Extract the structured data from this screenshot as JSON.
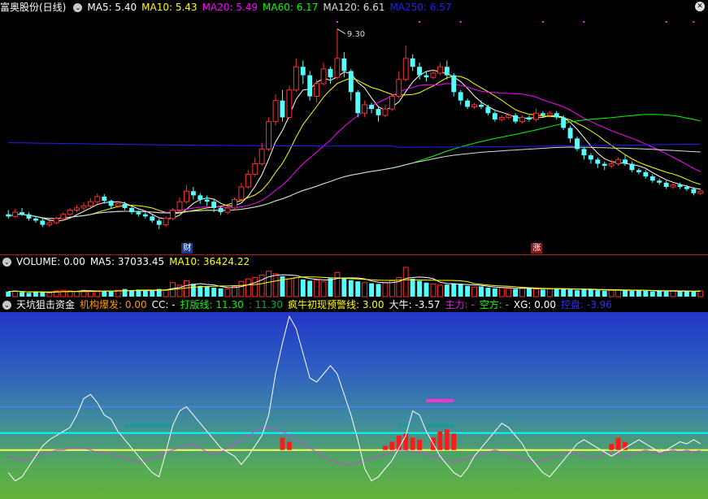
{
  "price_panel": {
    "title": "富奥股份(日线)",
    "ma_labels": [
      {
        "text": "MA5: 5.40",
        "color": "#ffffff"
      },
      {
        "text": "MA10: 5.43",
        "color": "#ffff00"
      },
      {
        "text": "MA20: 5.49",
        "color": "#ff00ff"
      },
      {
        "text": "MA60: 6.17",
        "color": "#00ff00"
      },
      {
        "text": "MA120: 6.61",
        "color": "#dcdcdc"
      },
      {
        "text": "MA250: 6.57",
        "color": "#2020ff"
      }
    ],
    "peak_label": "9.30",
    "event_tags": [
      {
        "text": "财",
        "color": "#1a3a8a"
      },
      {
        "text": "涨",
        "color": "#8a1a1a"
      }
    ]
  },
  "volume_panel": {
    "labels": [
      {
        "text": "VOLUME: 0.00",
        "color": "#ffffff"
      },
      {
        "text": "MA5: 37033.45",
        "color": "#ffffff"
      },
      {
        "text": "MA10: 36424.22",
        "color": "#ffff00"
      }
    ]
  },
  "indicator_panel": {
    "labels": [
      {
        "text": "天坑狙击资金",
        "color": "#ffffff"
      },
      {
        "text": "机构爆发: 0.00",
        "color": "#ff9900"
      },
      {
        "text": "CC: -",
        "color": "#ffffff"
      },
      {
        "text": "打版线: 11.30",
        "color": "#00ff00"
      },
      {
        "text": ": 11.30",
        "color": "#00aa55"
      },
      {
        "text": "疯牛初现预警线: 3.00",
        "color": "#ffff00"
      },
      {
        "text": "大牛: -3.57",
        "color": "#ffffff"
      },
      {
        "text": "主力: -",
        "color": "#ff00ff"
      },
      {
        "text": "空方: -",
        "color": "#00ff00"
      },
      {
        "text": "XG: 0.00",
        "color": "#ffffff"
      },
      {
        "text": "控盘: -3.96",
        "color": "#3030ff"
      }
    ]
  },
  "chart_data": [
    {
      "type": "candlestick",
      "title": "富奥股份(日线)",
      "ylim": [
        4.2,
        9.6
      ],
      "peak": 9.3,
      "candles": [
        [
          4.9,
          4.85,
          5.0,
          4.8
        ],
        [
          4.85,
          4.95,
          5.02,
          4.82
        ],
        [
          4.95,
          4.9,
          5.05,
          4.86
        ],
        [
          4.9,
          4.8,
          4.95,
          4.75
        ],
        [
          4.8,
          4.75,
          4.85,
          4.7
        ],
        [
          4.75,
          4.65,
          4.8,
          4.6
        ],
        [
          4.65,
          4.7,
          4.75,
          4.6
        ],
        [
          4.7,
          4.8,
          4.85,
          4.66
        ],
        [
          4.8,
          4.9,
          4.95,
          4.76
        ],
        [
          4.9,
          5.0,
          5.05,
          4.86
        ],
        [
          5.0,
          5.05,
          5.12,
          4.95
        ],
        [
          5.05,
          5.1,
          5.18,
          5.0
        ],
        [
          5.1,
          5.2,
          5.28,
          5.05
        ],
        [
          5.2,
          5.32,
          5.4,
          5.15
        ],
        [
          5.32,
          5.22,
          5.38,
          5.15
        ],
        [
          5.22,
          5.1,
          5.25,
          5.05
        ],
        [
          5.1,
          5.15,
          5.22,
          5.05
        ],
        [
          5.15,
          5.05,
          5.2,
          5.0
        ],
        [
          5.05,
          4.95,
          5.1,
          4.9
        ],
        [
          4.95,
          4.9,
          5.0,
          4.85
        ],
        [
          4.9,
          4.85,
          4.95,
          4.8
        ],
        [
          4.85,
          4.75,
          4.9,
          4.7
        ],
        [
          4.75,
          4.65,
          4.8,
          4.55
        ],
        [
          4.65,
          4.8,
          4.85,
          4.6
        ],
        [
          4.8,
          5.0,
          5.05,
          4.76
        ],
        [
          5.0,
          5.2,
          5.3,
          4.95
        ],
        [
          5.2,
          5.45,
          5.6,
          5.15
        ],
        [
          5.45,
          5.35,
          5.55,
          5.25
        ],
        [
          5.35,
          5.25,
          5.4,
          5.15
        ],
        [
          5.25,
          5.2,
          5.35,
          5.1
        ],
        [
          5.2,
          5.05,
          5.25,
          4.95
        ],
        [
          5.05,
          4.95,
          5.1,
          4.88
        ],
        [
          4.95,
          5.05,
          5.1,
          4.9
        ],
        [
          5.05,
          5.25,
          5.3,
          5.0
        ],
        [
          5.25,
          5.55,
          5.65,
          5.2
        ],
        [
          5.55,
          5.85,
          5.95,
          5.5
        ],
        [
          5.85,
          6.1,
          6.25,
          5.8
        ],
        [
          6.1,
          6.45,
          6.6,
          6.05
        ],
        [
          6.45,
          7.1,
          7.2,
          6.4
        ],
        [
          7.1,
          7.6,
          7.75,
          7.0
        ],
        [
          7.6,
          7.2,
          7.85,
          7.1
        ],
        [
          7.2,
          7.85,
          7.95,
          7.15
        ],
        [
          7.85,
          8.4,
          8.6,
          7.8
        ],
        [
          8.4,
          8.2,
          8.55,
          8.0
        ],
        [
          8.2,
          7.7,
          8.3,
          7.6
        ],
        [
          7.7,
          8.0,
          8.1,
          7.55
        ],
        [
          8.0,
          8.35,
          8.5,
          7.95
        ],
        [
          8.35,
          8.15,
          8.4,
          8.0
        ],
        [
          8.15,
          8.6,
          9.3,
          8.1
        ],
        [
          8.6,
          8.3,
          8.75,
          8.15
        ],
        [
          8.3,
          7.8,
          8.35,
          7.6
        ],
        [
          7.8,
          7.3,
          7.85,
          7.2
        ],
        [
          7.3,
          7.5,
          7.6,
          7.2
        ],
        [
          7.5,
          7.4,
          7.55,
          7.3
        ],
        [
          7.4,
          7.25,
          7.45,
          7.1
        ],
        [
          7.25,
          7.4,
          7.5,
          7.2
        ],
        [
          7.4,
          7.7,
          7.75,
          7.35
        ],
        [
          7.7,
          8.1,
          8.3,
          7.65
        ],
        [
          8.1,
          8.6,
          8.9,
          8.05
        ],
        [
          8.6,
          8.4,
          8.7,
          8.3
        ],
        [
          8.4,
          8.2,
          8.5,
          8.1
        ],
        [
          8.2,
          8.15,
          8.3,
          8.05
        ],
        [
          8.15,
          8.25,
          8.35,
          8.1
        ],
        [
          8.25,
          8.4,
          8.5,
          8.2
        ],
        [
          8.4,
          8.2,
          8.55,
          8.1
        ],
        [
          8.2,
          7.8,
          8.25,
          7.7
        ],
        [
          7.8,
          7.6,
          7.85,
          7.5
        ],
        [
          7.6,
          7.45,
          7.65,
          7.4
        ],
        [
          7.45,
          7.5,
          7.55,
          7.4
        ],
        [
          7.5,
          7.45,
          7.6,
          7.4
        ],
        [
          7.45,
          7.3,
          7.5,
          7.25
        ],
        [
          7.3,
          7.15,
          7.35,
          7.1
        ],
        [
          7.15,
          7.2,
          7.25,
          7.1
        ],
        [
          7.2,
          7.25,
          7.3,
          7.15
        ],
        [
          7.25,
          7.1,
          7.3,
          7.05
        ],
        [
          7.1,
          7.2,
          7.25,
          7.05
        ],
        [
          7.2,
          7.15,
          7.25,
          7.1
        ],
        [
          7.15,
          7.3,
          7.4,
          7.1
        ],
        [
          7.3,
          7.25,
          7.35,
          7.2
        ],
        [
          7.25,
          7.3,
          7.35,
          7.2
        ],
        [
          7.3,
          7.2,
          7.35,
          7.15
        ],
        [
          7.2,
          6.95,
          7.25,
          6.9
        ],
        [
          6.95,
          6.7,
          7.0,
          6.6
        ],
        [
          6.7,
          6.45,
          6.75,
          6.4
        ],
        [
          6.45,
          6.3,
          6.5,
          6.2
        ],
        [
          6.3,
          6.2,
          6.35,
          6.1
        ],
        [
          6.2,
          6.1,
          6.25,
          6.0
        ],
        [
          6.1,
          6.05,
          6.15,
          5.95
        ],
        [
          6.05,
          6.1,
          6.2,
          6.0
        ],
        [
          6.1,
          6.2,
          6.25,
          6.05
        ],
        [
          6.2,
          6.1,
          6.3,
          6.05
        ],
        [
          6.1,
          5.95,
          6.15,
          5.9
        ],
        [
          5.95,
          5.9,
          6.0,
          5.85
        ],
        [
          5.9,
          5.8,
          5.95,
          5.75
        ],
        [
          5.8,
          5.7,
          5.85,
          5.65
        ],
        [
          5.7,
          5.65,
          5.75,
          5.6
        ],
        [
          5.65,
          5.55,
          5.7,
          5.5
        ],
        [
          5.55,
          5.6,
          5.65,
          5.5
        ],
        [
          5.6,
          5.55,
          5.65,
          5.5
        ],
        [
          5.55,
          5.5,
          5.6,
          5.45
        ],
        [
          5.5,
          5.4,
          5.55,
          5.35
        ],
        [
          5.4,
          5.45,
          5.5,
          5.35
        ]
      ],
      "ma_series": [
        {
          "name": "MA5",
          "color": "#ffffff"
        },
        {
          "name": "MA10",
          "color": "#ffff00"
        },
        {
          "name": "MA20",
          "color": "#ff00ff"
        },
        {
          "name": "MA60",
          "color": "#00ff00"
        },
        {
          "name": "MA120",
          "color": "#dcdcdc"
        },
        {
          "name": "MA250",
          "color": "#2020ff",
          "values_hint": "flat near 6.6 then 6.57"
        }
      ]
    },
    {
      "type": "bar",
      "title": "VOLUME",
      "ma5": 37033.45,
      "ma10": 36424.22,
      "values": [
        8,
        9,
        7,
        6,
        8,
        7,
        6,
        9,
        10,
        9,
        8,
        10,
        9,
        8,
        9,
        8,
        10,
        12,
        9,
        11,
        10,
        9,
        12,
        11,
        22,
        18,
        25,
        20,
        17,
        16,
        14,
        13,
        12,
        16,
        24,
        28,
        30,
        34,
        40,
        36,
        32,
        28,
        30,
        27,
        25,
        26,
        24,
        29,
        38,
        30,
        26,
        24,
        22,
        21,
        20,
        22,
        25,
        30,
        46,
        28,
        25,
        22,
        20,
        18,
        19,
        21,
        20,
        17,
        15,
        16,
        14,
        13,
        14,
        13,
        12,
        13,
        14,
        12,
        11,
        12,
        13,
        12,
        11,
        10,
        12,
        11,
        10,
        9,
        10,
        11,
        10,
        9,
        10,
        9,
        8,
        9,
        8,
        9,
        8,
        9,
        8,
        9
      ]
    },
    {
      "type": "line",
      "title": "天坑狙击资金",
      "ylim": [
        -20,
        70
      ],
      "ref_lines": [
        {
          "name": "打版线",
          "value": 11.3,
          "color": "#00ffff"
        },
        {
          "name": "疯牛初现预警线",
          "value": 3.0,
          "color": "#ffff55"
        },
        {
          "name": "",
          "value": 24.0,
          "color": "#4c80e0"
        }
      ],
      "white_line": [
        -8,
        -12,
        -10,
        -5,
        0,
        5,
        8,
        10,
        12,
        14,
        20,
        28,
        30,
        26,
        20,
        18,
        12,
        8,
        4,
        0,
        -4,
        -8,
        -10,
        2,
        15,
        22,
        24,
        20,
        16,
        12,
        8,
        4,
        2,
        0,
        -4,
        0,
        5,
        10,
        20,
        40,
        55,
        68,
        62,
        50,
        38,
        36,
        40,
        44,
        40,
        30,
        20,
        8,
        -6,
        -12,
        -10,
        -6,
        -2,
        4,
        10,
        22,
        20,
        12,
        6,
        0,
        -4,
        -8,
        -10,
        -6,
        0,
        4,
        8,
        12,
        16,
        14,
        10,
        6,
        0,
        -4,
        -8,
        -10,
        -6,
        -2,
        2,
        6,
        8,
        6,
        4,
        2,
        0,
        2,
        4,
        6,
        8,
        6,
        4,
        2,
        3,
        5,
        7,
        6,
        8,
        6
      ],
      "magenta_line": [
        0,
        -1,
        -2,
        -1,
        0,
        1,
        2,
        3,
        3,
        4,
        4,
        4,
        3,
        2,
        2,
        1,
        0,
        -1,
        -2,
        -3,
        -2,
        -1,
        0,
        2,
        3,
        4,
        5,
        6,
        4,
        2,
        1,
        2,
        4,
        6,
        8,
        10,
        12,
        14,
        14,
        13,
        12,
        10,
        8,
        6,
        4,
        2,
        0,
        -2,
        -3,
        -4,
        -4,
        -3,
        -2,
        -1,
        0,
        1,
        2,
        3,
        3,
        2,
        2,
        1,
        0,
        -1,
        -2,
        -3,
        -2,
        -1,
        0,
        1,
        2,
        3,
        2,
        1,
        0,
        -1,
        -2,
        -3,
        -2,
        -1,
        0,
        1,
        2,
        1,
        0,
        -1,
        0,
        1,
        2,
        1,
        0,
        1,
        2,
        3,
        2,
        1,
        2,
        3,
        2,
        3,
        2,
        3
      ],
      "red_bars": [
        {
          "idx": 40,
          "value": 6
        },
        {
          "idx": 41,
          "value": 4
        },
        {
          "idx": 55,
          "value": 2
        },
        {
          "idx": 56,
          "value": 4
        },
        {
          "idx": 57,
          "value": 7
        },
        {
          "idx": 58,
          "value": 8
        },
        {
          "idx": 59,
          "value": 6
        },
        {
          "idx": 60,
          "value": 5
        },
        {
          "idx": 62,
          "value": 6
        },
        {
          "idx": 63,
          "value": 9
        },
        {
          "idx": 64,
          "value": 10
        },
        {
          "idx": 65,
          "value": 8
        },
        {
          "idx": 88,
          "value": 3
        },
        {
          "idx": 89,
          "value": 6
        },
        {
          "idx": 90,
          "value": 4
        }
      ],
      "teal_segments": [
        {
          "from": 17,
          "to": 24,
          "value": 15
        },
        {
          "from": 57,
          "to": 59,
          "value": 15
        },
        {
          "from": 61,
          "to": 65,
          "value": 15
        }
      ],
      "magenta_segment": {
        "from": 61,
        "to": 65,
        "value": 27
      }
    }
  ]
}
